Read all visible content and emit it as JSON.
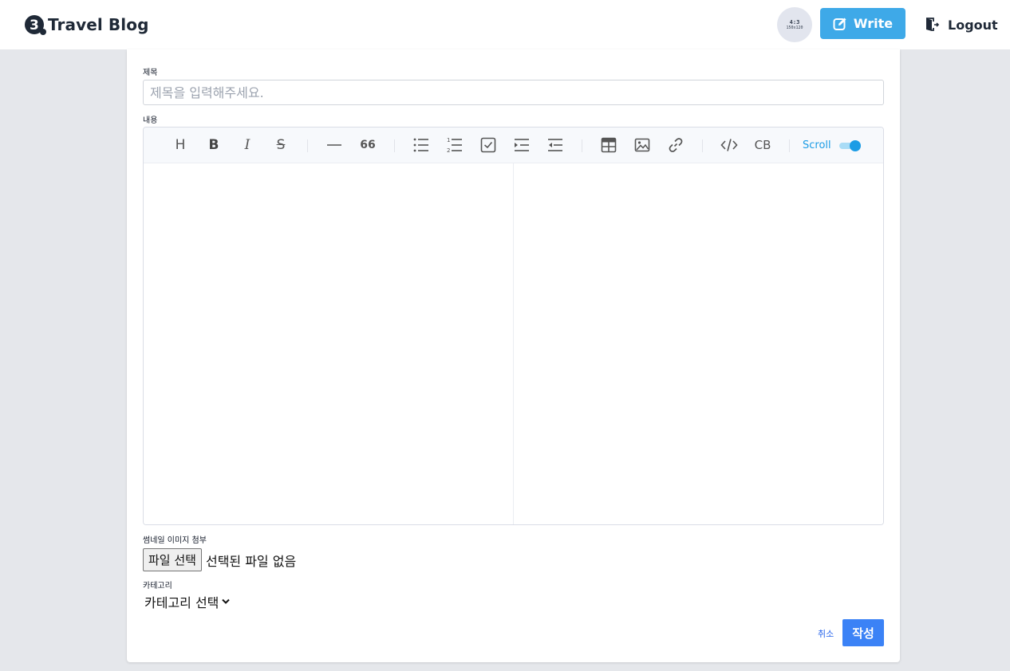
{
  "header": {
    "brand_text": "Travel Blog",
    "avatar_line1": "4:3",
    "avatar_line2": "150x120",
    "write_label": "Write",
    "logout_label": "Logout",
    "accent_color": "#3ea9e8"
  },
  "form": {
    "title_label": "제목",
    "title_placeholder": "제목을 입력해주세요.",
    "content_label": "내용",
    "thumbnail_label": "썸네일 이미지 첨부",
    "file_button_label": "파일 선택",
    "file_status": "선택된 파일 없음",
    "category_label": "카테고리",
    "category_selected": "카테고리 선택",
    "cancel_label": "취소",
    "submit_label": "작성",
    "submit_color": "#3b82f6"
  },
  "editor": {
    "toolbar_icons": [
      "heading-icon",
      "bold-icon",
      "italic-icon",
      "strike-icon",
      "hr-icon",
      "quote-icon",
      "bullet-list-icon",
      "ordered-list-icon",
      "task-list-icon",
      "indent-icon",
      "outdent-icon",
      "table-icon",
      "image-icon",
      "link-icon",
      "code-icon",
      "codeblock-icon"
    ],
    "heading_glyph": "H",
    "bold_glyph": "B",
    "italic_glyph": "I",
    "strike_glyph": "S",
    "quote_glyph": "66",
    "codeblock_glyph": "CB",
    "scroll_label": "Scroll",
    "scroll_sync_on": true
  }
}
